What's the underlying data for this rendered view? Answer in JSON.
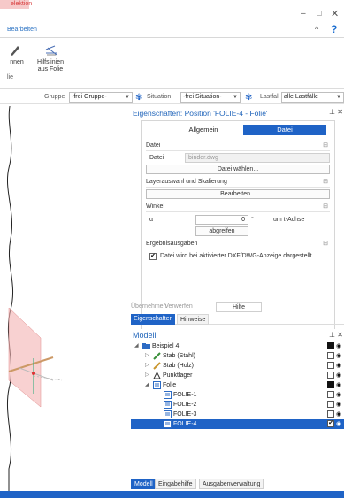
{
  "ribbon": {
    "active_tab": "elektion",
    "sub_label": "Bearbeiten",
    "btn1_label": "nnen",
    "btn2_label": "Hilfslinien aus Folie",
    "small_label": "lie",
    "help_glyph": "?"
  },
  "toolbar": {
    "gruppe_label": "Gruppe",
    "gruppe_value": "-frei Gruppe-",
    "situation_label": "Situation",
    "situation_value": "-frei Situation-",
    "lastfall_label": "Lastfall",
    "lastfall_value": "alle Lastfälle"
  },
  "properties": {
    "title": "Eigenschaften: Position 'FOLIE-4 - Folie'",
    "tab_general": "Allgemein",
    "tab_file": "Datei",
    "section_file": "Datei",
    "file_label": "Datei",
    "file_value": "binder.dwg",
    "choose_file_button": "Datei wählen...",
    "section_layer": "Layerauswahl und Skalierung",
    "edit_button": "Bearbeiten...",
    "section_angle": "Winkel",
    "alpha_label": "α",
    "alpha_value": "0",
    "alpha_unit": "°",
    "axis_text": "um t-Achse",
    "pick_button": "abgreifen",
    "section_output": "Ergebnisausgaben",
    "output_checkbox_label": "Datei wird bei aktivierter DXF/DWG-Anzeige dargestellt",
    "output_checked": true
  },
  "bottom_buttons": {
    "apply": "Übernehmen",
    "discard": "Verwerfen",
    "help": "Hilfe"
  },
  "sub_tabs": [
    "Eigenschaften",
    "Hinweise"
  ],
  "model": {
    "title": "Modell",
    "items": [
      {
        "label": "Beispiel 4",
        "level": 0,
        "expander": "◢",
        "icon": "folder-icon",
        "right": "filled"
      },
      {
        "label": "Stab (Stahl)",
        "level": 1,
        "expander": "▷",
        "icon": "steel-bar-icon",
        "right": "empty"
      },
      {
        "label": "Stab (Holz)",
        "level": 1,
        "expander": "▷",
        "icon": "wood-bar-icon",
        "right": "empty"
      },
      {
        "label": "Punktlager",
        "level": 1,
        "expander": "▷",
        "icon": "support-icon",
        "right": "empty"
      },
      {
        "label": "Folie",
        "level": 1,
        "expander": "◢",
        "icon": "layer-icon",
        "right": "filled"
      },
      {
        "label": "FOLIE-1",
        "level": 2,
        "expander": "",
        "icon": "layer-icon",
        "right": "empty"
      },
      {
        "label": "FOLIE-2",
        "level": 2,
        "expander": "",
        "icon": "layer-icon",
        "right": "empty"
      },
      {
        "label": "FOLIE-3",
        "level": 2,
        "expander": "",
        "icon": "layer-icon",
        "right": "empty"
      },
      {
        "label": "FOLIE-4",
        "level": 2,
        "expander": "",
        "icon": "layer-icon",
        "right": "check",
        "selected": true
      }
    ]
  },
  "bottom_tabs": [
    "Modell",
    "Eingabehilfe",
    "Ausgabenverwaltung"
  ],
  "colors": {
    "accent": "#1f63c6",
    "title_blue": "#2266bb",
    "ribbon_tab_bg": "#f6c9c9",
    "ribbon_tab_text": "#d83b3b"
  }
}
